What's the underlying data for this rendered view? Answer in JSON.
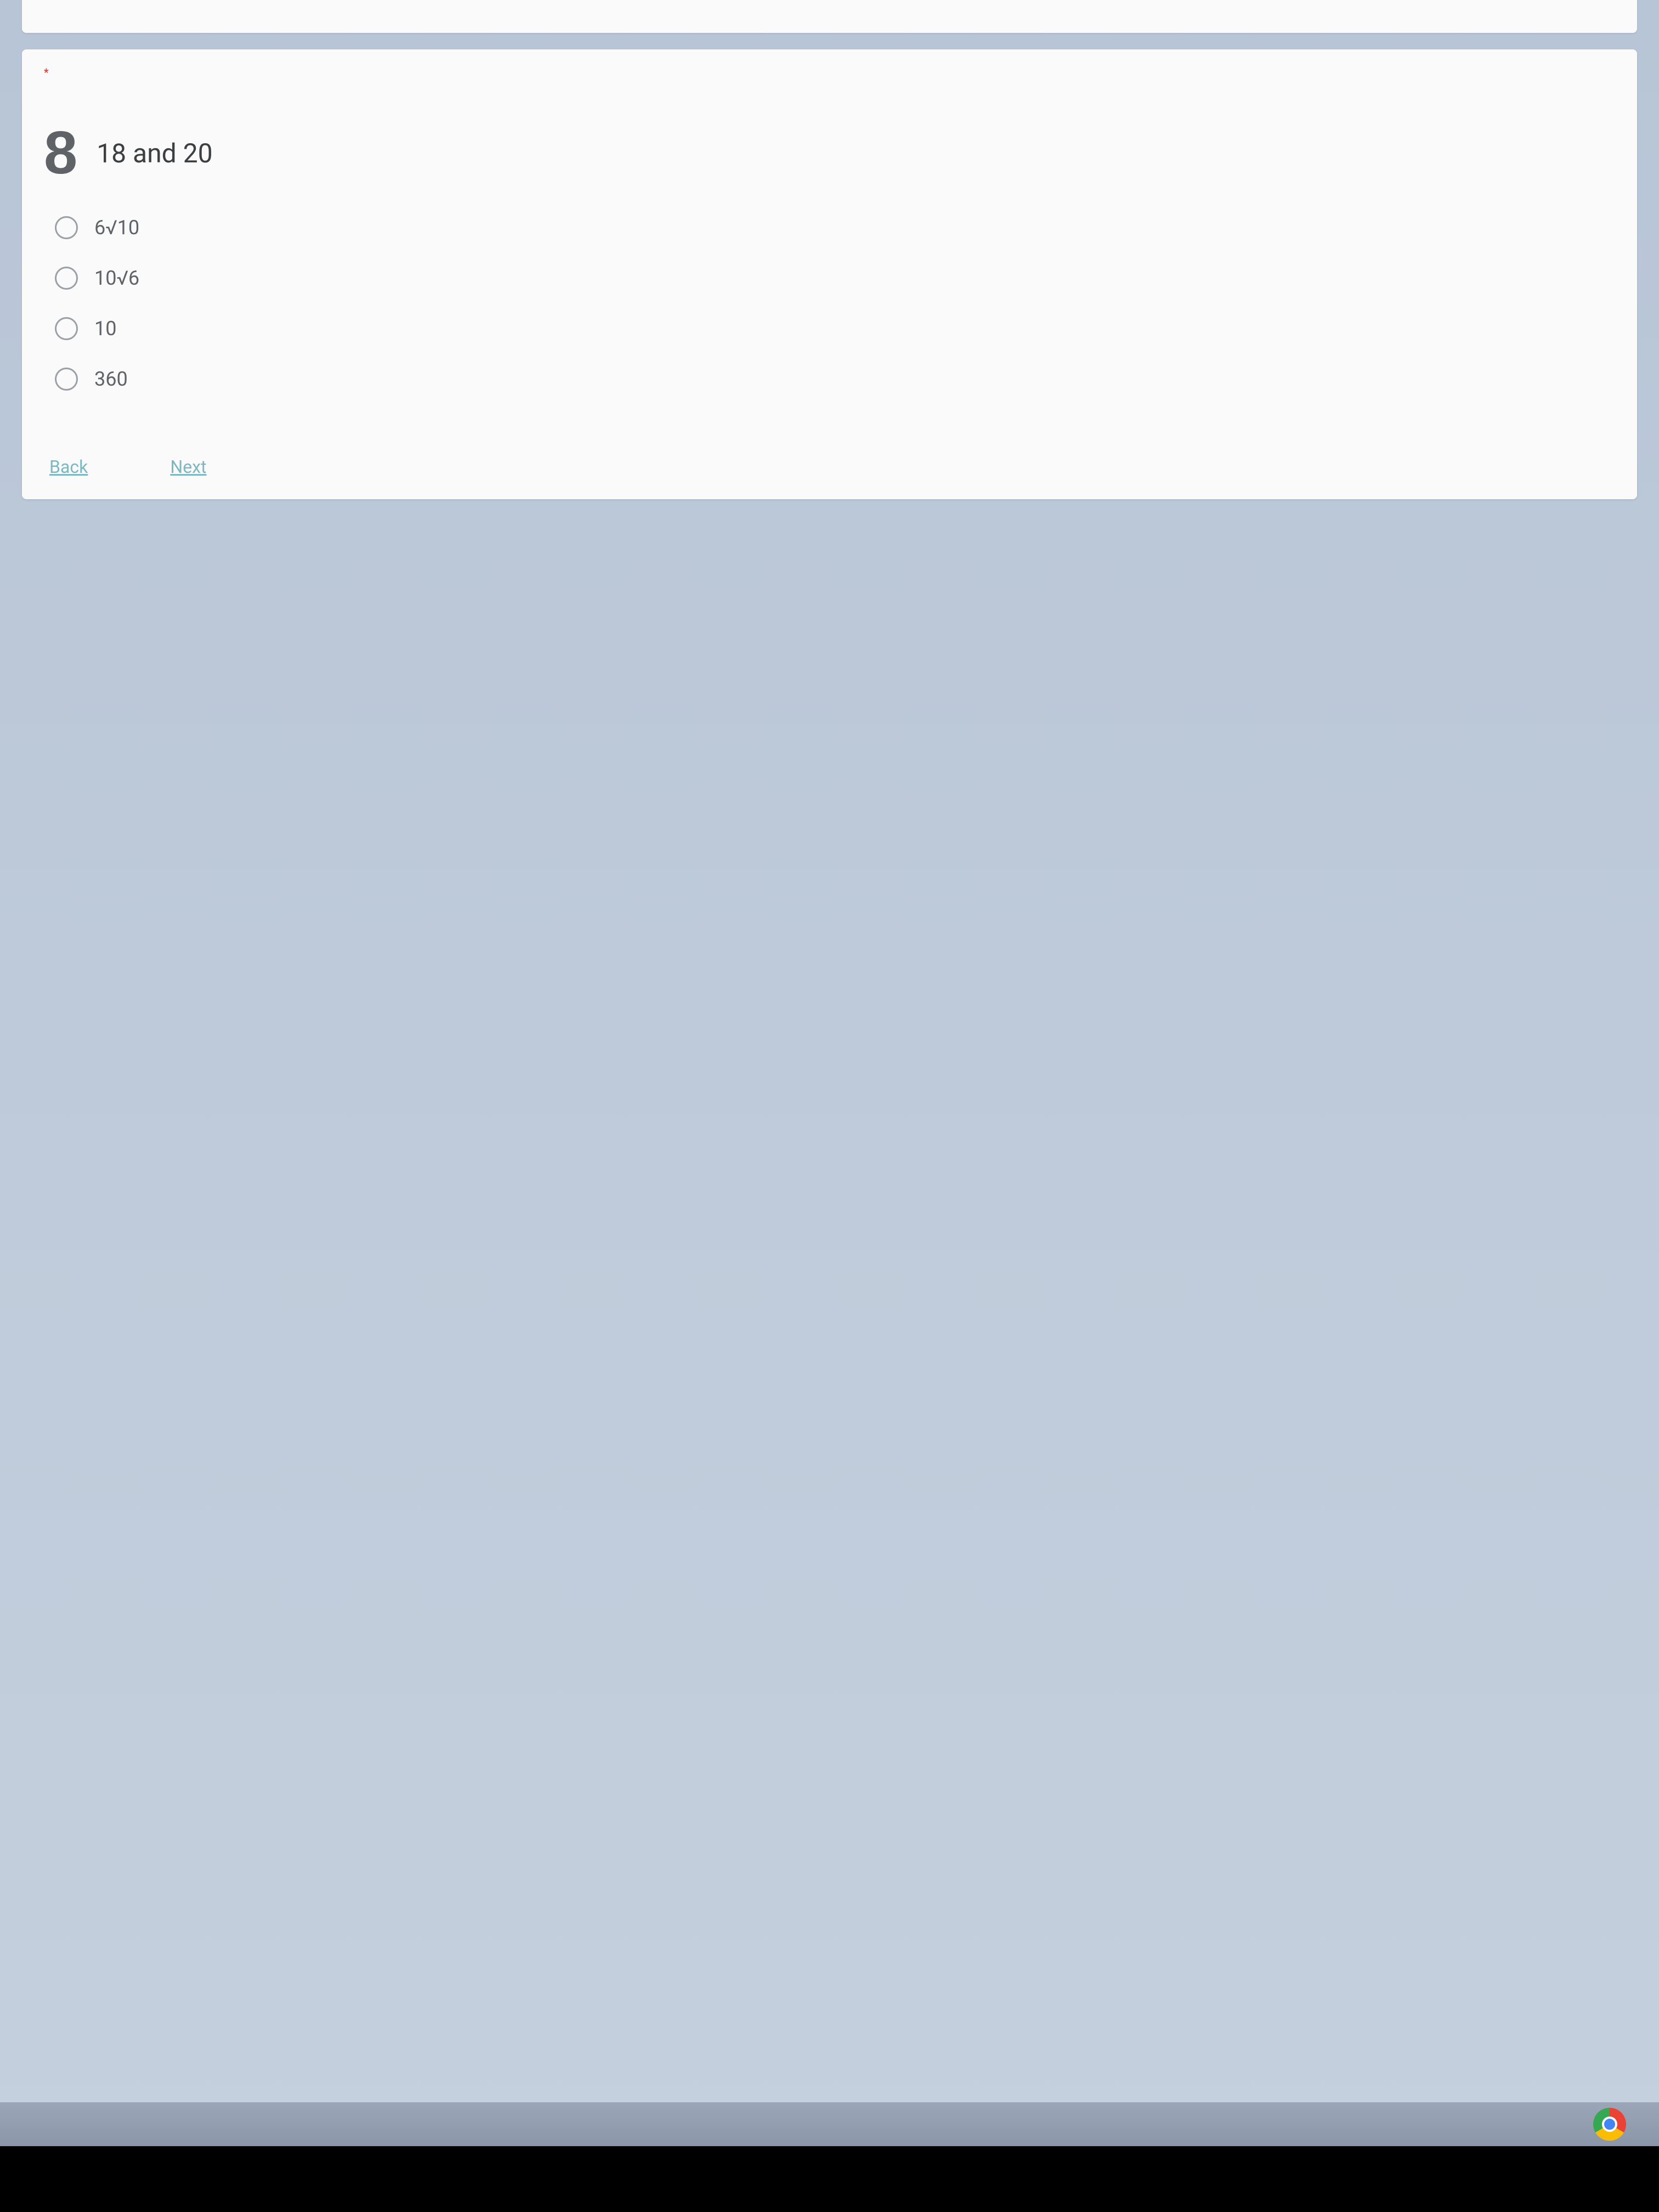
{
  "required_marker": "*",
  "question": {
    "number": "8",
    "text": "18 and 20"
  },
  "options": [
    {
      "label": "6√10"
    },
    {
      "label": "10√6"
    },
    {
      "label": "10"
    },
    {
      "label": "360"
    }
  ],
  "navigation": {
    "back_label": "Back",
    "next_label": "Next"
  }
}
